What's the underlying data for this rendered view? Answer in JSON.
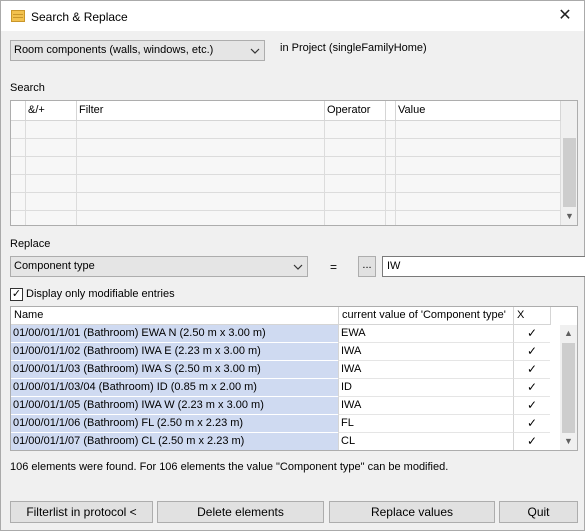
{
  "window": {
    "title": "Search & Replace",
    "close_glyph": "✕"
  },
  "top": {
    "category_value": "Room components (walls, windows, etc.)",
    "project_label": "in Project (singleFamilyHome)"
  },
  "search": {
    "label": "Search",
    "columns": [
      "&/+",
      "Filter",
      "Operator",
      "Value"
    ]
  },
  "replace": {
    "label": "Replace",
    "attribute_value": "Component type",
    "equals": "=",
    "browse_label": "...",
    "new_value": "IW"
  },
  "filter_checkbox": {
    "checked": true,
    "label": "Display only modifiable entries",
    "check_glyph": "✓"
  },
  "results": {
    "columns": [
      "Name",
      "current value of 'Component type'",
      "X"
    ],
    "rows": [
      {
        "name": "01/00/01/1/01 (Bathroom) EWA N (2.50 m x 3.00 m)",
        "value": "EWA",
        "checked": "✓"
      },
      {
        "name": "01/00/01/1/02 (Bathroom) IWA E (2.23 m x 3.00 m)",
        "value": "IWA",
        "checked": "✓"
      },
      {
        "name": "01/00/01/1/03 (Bathroom) IWA S (2.50 m x 3.00 m)",
        "value": "IWA",
        "checked": "✓"
      },
      {
        "name": "01/00/01/1/03/04 (Bathroom) ID (0.85 m x 2.00 m)",
        "value": "ID",
        "checked": "✓"
      },
      {
        "name": "01/00/01/1/05 (Bathroom) IWA W (2.23 m x 3.00 m)",
        "value": "IWA",
        "checked": "✓"
      },
      {
        "name": "01/00/01/1/06 (Bathroom) FL (2.50 m x 2.23 m)",
        "value": "FL",
        "checked": "✓"
      },
      {
        "name": "01/00/01/1/07 (Bathroom) CL (2.50 m x 2.23 m)",
        "value": "CL",
        "checked": "✓"
      }
    ]
  },
  "status_text": "106 elements were found. For 106 elements the value \"Component type\" can be modified.",
  "buttons": {
    "filterlist": "Filterlist in protocol <",
    "delete": "Delete elements",
    "replace": "Replace values",
    "quit": "Quit"
  }
}
